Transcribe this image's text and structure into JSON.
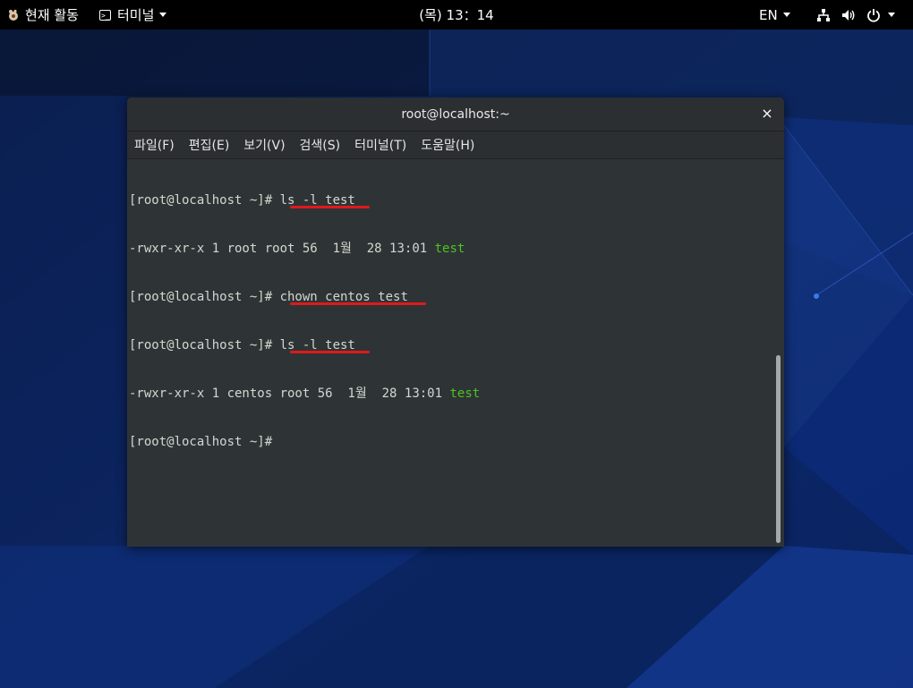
{
  "topbar": {
    "activities_label": "현재 활동",
    "app_menu_label": "터미널",
    "clock": "(목) 13：14",
    "language": "EN"
  },
  "window": {
    "title": "root@localhost:~",
    "close_label": "×",
    "menu": [
      "파일(F)",
      "편집(E)",
      "보기(V)",
      "검색(S)",
      "터미널(T)",
      "도움말(H)"
    ]
  },
  "terminal": {
    "prompt": "[root@localhost ~]# ",
    "lines": [
      {
        "type": "command",
        "text": "ls -l test"
      },
      {
        "type": "output",
        "text": "-rwxr-xr-x 1 root root 56  1월  28 13:01 ",
        "highlight": "test"
      },
      {
        "type": "command",
        "text": "chown centos test"
      },
      {
        "type": "command",
        "text": "ls -l test"
      },
      {
        "type": "output",
        "text": "-rwxr-xr-x 1 centos root 56  1월  28 13:01 ",
        "highlight": "test"
      },
      {
        "type": "command",
        "text": ""
      }
    ]
  },
  "icons": {
    "activities": "gnome-logo-icon",
    "app_menu": "terminal-icon",
    "network": "network-icon",
    "volume": "volume-icon",
    "power": "power-icon"
  },
  "colors": {
    "terminal_bg": "#2e3436",
    "terminal_fg": "#d3d7cf",
    "highlight_green": "#4ec31f",
    "underline_red": "#e0191b",
    "topbar_bg": "#000000"
  }
}
